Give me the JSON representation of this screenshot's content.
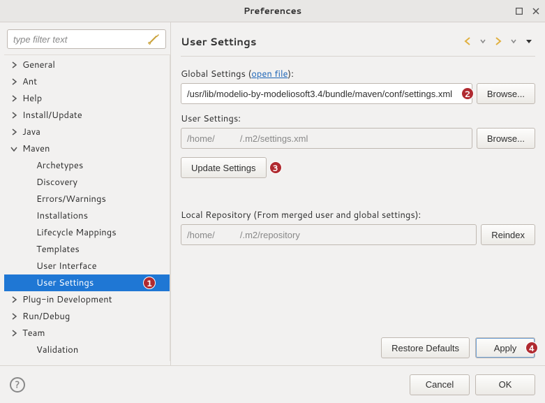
{
  "window": {
    "title": "Preferences"
  },
  "sidebar": {
    "filter_placeholder": "type filter text",
    "items": [
      {
        "label": "General",
        "depth": 0,
        "expanded": false,
        "arrow": true
      },
      {
        "label": "Ant",
        "depth": 0,
        "expanded": false,
        "arrow": true
      },
      {
        "label": "Help",
        "depth": 0,
        "expanded": false,
        "arrow": true
      },
      {
        "label": "Install/Update",
        "depth": 0,
        "expanded": false,
        "arrow": true
      },
      {
        "label": "Java",
        "depth": 0,
        "expanded": false,
        "arrow": true
      },
      {
        "label": "Maven",
        "depth": 0,
        "expanded": true,
        "arrow": true
      },
      {
        "label": "Archetypes",
        "depth": 1,
        "arrow": false
      },
      {
        "label": "Discovery",
        "depth": 1,
        "arrow": false
      },
      {
        "label": "Errors/Warnings",
        "depth": 1,
        "arrow": false
      },
      {
        "label": "Installations",
        "depth": 1,
        "arrow": false
      },
      {
        "label": "Lifecycle Mappings",
        "depth": 1,
        "arrow": false
      },
      {
        "label": "Templates",
        "depth": 1,
        "arrow": false
      },
      {
        "label": "User Interface",
        "depth": 1,
        "arrow": false
      },
      {
        "label": "User Settings",
        "depth": 1,
        "arrow": false,
        "selected": true,
        "badge": "1"
      },
      {
        "label": "Plug-in Development",
        "depth": 0,
        "expanded": false,
        "arrow": true
      },
      {
        "label": "Run/Debug",
        "depth": 0,
        "expanded": false,
        "arrow": true
      },
      {
        "label": "Team",
        "depth": 0,
        "expanded": false,
        "arrow": true
      },
      {
        "label": "Validation",
        "depth": 1,
        "arrow": false
      }
    ]
  },
  "page": {
    "title": "User Settings",
    "global_label_prefix": "Global Settings (",
    "global_label_link": "open file",
    "global_label_suffix": "):",
    "global_value": "/usr/lib/modelio-by-modeliosoft3.4/bundle/maven/conf/settings.xml",
    "browse1": "Browse...",
    "user_label": "User Settings:",
    "user_value": "/home/          /.m2/settings.xml",
    "browse2": "Browse...",
    "update_btn": "Update Settings",
    "repo_label": "Local Repository (From merged user and global settings):",
    "repo_value": "/home/          /.m2/repository",
    "reindex_btn": "Reindex",
    "restore_btn": "Restore Defaults",
    "apply_btn": "Apply",
    "badges": {
      "global": "2",
      "update": "3",
      "apply": "4"
    }
  },
  "footer": {
    "cancel": "Cancel",
    "ok": "OK"
  }
}
